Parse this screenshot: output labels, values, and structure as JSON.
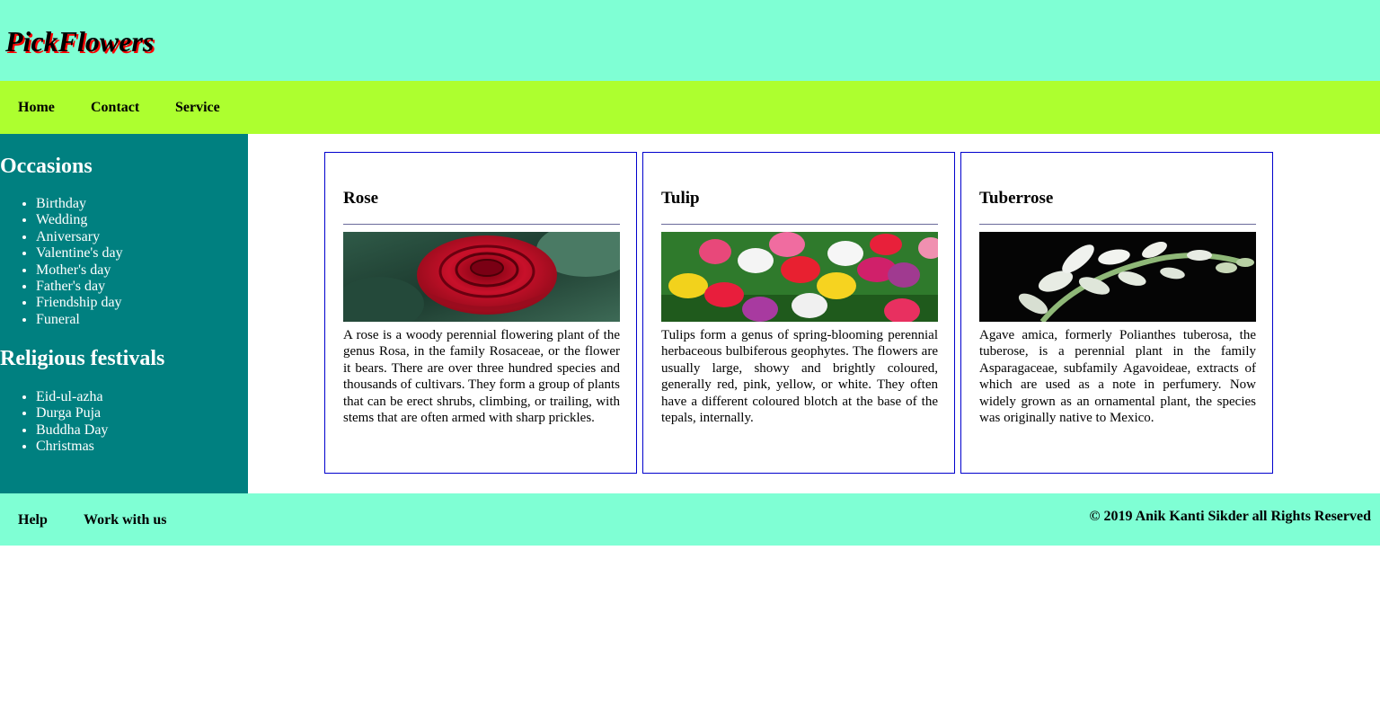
{
  "header": {
    "logo": "PickFlowers"
  },
  "nav": {
    "items": [
      "Home",
      "Contact",
      "Service"
    ]
  },
  "sidebar": {
    "sections": [
      {
        "heading": "Occasions",
        "items": [
          "Birthday",
          "Wedding",
          "Aniversary",
          "Valentine's day",
          "Mother's day",
          "Father's day",
          "Friendship day",
          "Funeral"
        ]
      },
      {
        "heading": "Religious festivals",
        "items": [
          "Eid-ul-azha",
          "Durga Puja",
          "Buddha Day",
          "Christmas"
        ]
      }
    ]
  },
  "cards": [
    {
      "title": "Rose",
      "image": "rose-photo",
      "text": "A rose is a woody perennial flowering plant of the genus Rosa, in the family Rosaceae, or the flower it bears. There are over three hundred species and thousands of cultivars. They form a group of plants that can be erect shrubs, climbing, or trailing, with stems that are often armed with sharp prickles."
    },
    {
      "title": "Tulip",
      "image": "tulip-photo",
      "text": "Tulips form a genus of spring-blooming perennial herbaceous bulbiferous geophytes. The flowers are usually large, showy and brightly coloured, generally red, pink, yellow, or white. They often have a different coloured blotch at the base of the tepals, internally."
    },
    {
      "title": "Tuberrose",
      "image": "tuberose-photo",
      "text": "Agave amica, formerly Polianthes tuberosa, the tuberose, is a perennial plant in the family Asparagaceae, subfamily Agavoideae, extracts of which are used as a note in perfumery. Now widely grown as an ornamental plant, the species was originally native to Mexico."
    }
  ],
  "footer": {
    "links": [
      "Help",
      "Work with us"
    ],
    "copyright": "© 2019 Anik Kanti Sikder all Rights Reserved"
  },
  "colors": {
    "header_bg": "#7fffd4",
    "nav_bg": "#adff2f",
    "sidebar_bg": "#008080",
    "card_border": "#0000cd",
    "logo_shadow": "#ff0000"
  }
}
